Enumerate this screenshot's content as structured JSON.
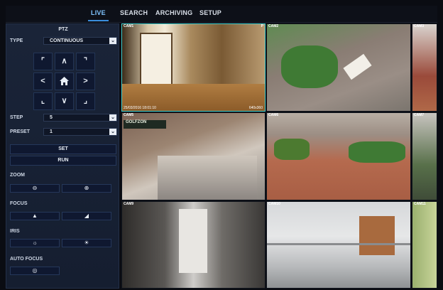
{
  "nav": {
    "tabs": [
      "LIVE",
      "SEARCH",
      "ARCHIVING",
      "SETUP"
    ],
    "active": "LIVE"
  },
  "ptz": {
    "title": "PTZ",
    "type_label": "TYPE",
    "type_value": "CONTINUOUS",
    "step_label": "STEP",
    "step_value": "5",
    "preset_label": "PRESET",
    "preset_value": "1",
    "set_label": "SET",
    "run_label": "RUN",
    "zoom_label": "ZOOM",
    "focus_label": "FOCUS",
    "iris_label": "IRIS",
    "autofocus_label": "AUTO FOCUS"
  },
  "cameras": [
    {
      "name": "CAM1",
      "right": "P",
      "stamp": "25/03/2016 18:01:10",
      "res": "640x360"
    },
    {
      "name": "CAM2"
    },
    {
      "name": "CAM3"
    },
    {
      "name": "CAM5"
    },
    {
      "name": "CAM6"
    },
    {
      "name": "CAM7"
    },
    {
      "name": "CAM9"
    },
    {
      "name": "CAM10"
    },
    {
      "name": "CAM11"
    }
  ],
  "cam5_sign": "GOLFZON",
  "colors": {
    "accent": "#3a8ddc",
    "panel": "#1a2438",
    "selected_border": "#3fd0d0"
  }
}
